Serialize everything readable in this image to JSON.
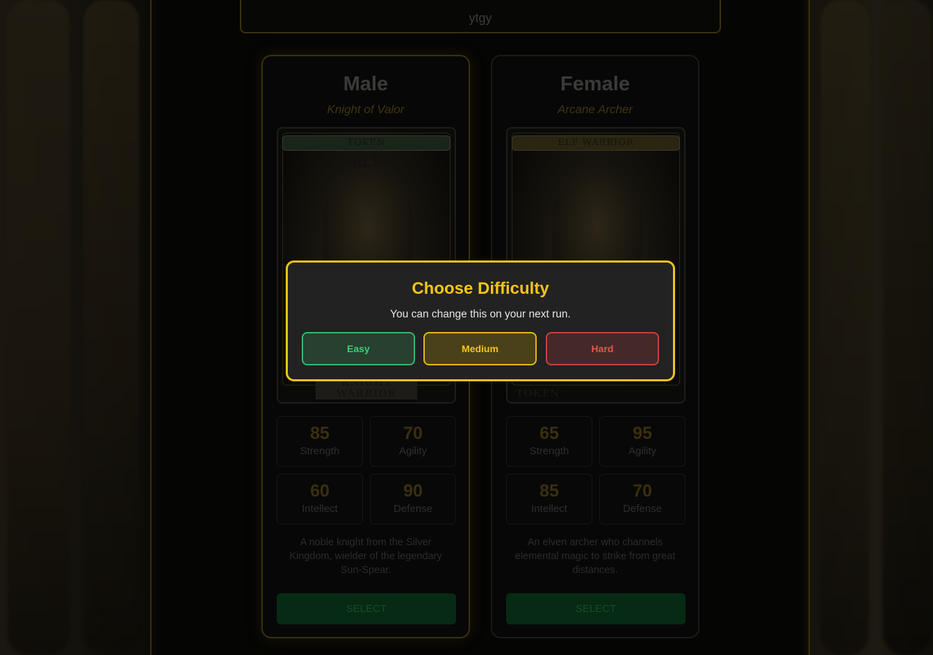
{
  "name_input": {
    "value": "ytgy"
  },
  "characters": [
    {
      "name": "Male",
      "subtitle": "Knight of Valor",
      "art": {
        "banner": "TOKEN",
        "top_word": "ELF",
        "bottom_word": "KNIGHT WARRIOR"
      },
      "stats": [
        {
          "value": "85",
          "label": "Strength"
        },
        {
          "value": "70",
          "label": "Agility"
        },
        {
          "value": "60",
          "label": "Intellect"
        },
        {
          "value": "90",
          "label": "Defense"
        }
      ],
      "description": "A noble knight from the Silver Kingdom, wielder of the legendary Sun-Spear.",
      "select_label": "SELECT"
    },
    {
      "name": "Female",
      "subtitle": "Arcane Archer",
      "art": {
        "banner": "ELF WARRIOR",
        "top_word": "",
        "bottom_word": "TOKEN"
      },
      "stats": [
        {
          "value": "65",
          "label": "Strength"
        },
        {
          "value": "95",
          "label": "Agility"
        },
        {
          "value": "85",
          "label": "Intellect"
        },
        {
          "value": "70",
          "label": "Defense"
        }
      ],
      "description": "An elven archer who channels elemental magic to strike from great distances.",
      "select_label": "SELECT"
    }
  ],
  "modal": {
    "title": "Choose Difficulty",
    "message": "You can change this on your next run.",
    "buttons": {
      "easy": "Easy",
      "medium": "Medium",
      "hard": "Hard"
    }
  },
  "colors": {
    "accent": "#f5c518",
    "easy": "#3dcf78",
    "medium": "#f5c518",
    "hard": "#e8554d",
    "select_bg": "#062a14"
  }
}
